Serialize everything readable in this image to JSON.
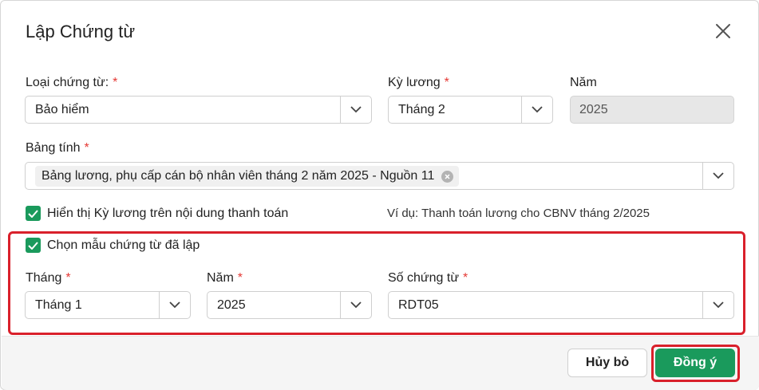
{
  "dialog": {
    "title": "Lập Chứng từ",
    "close_icon": "close-icon"
  },
  "fields": {
    "voucher_type": {
      "label": "Loại chứng từ:",
      "required": "*",
      "value": "Bảo hiểm"
    },
    "pay_period": {
      "label": "Kỳ lương",
      "required": "*",
      "value": "Tháng 2"
    },
    "year": {
      "label": "Năm",
      "value": "2025"
    },
    "spreadsheet": {
      "label": "Bảng tính",
      "required": "*",
      "tag": "Bảng lương, phụ cấp cán bộ nhân viên tháng 2 năm 2025 - Nguồn 11"
    }
  },
  "options": {
    "show_period": {
      "label": "Hiển thị Kỳ lương trên nội dung thanh toán",
      "checked": true
    },
    "example": "Ví dụ: Thanh toán lương cho CBNV tháng 2/2025",
    "choose_template": {
      "label": "Chọn mẫu chứng từ đã lập",
      "checked": true
    }
  },
  "template": {
    "month": {
      "label": "Tháng",
      "required": "*",
      "value": "Tháng 1"
    },
    "year": {
      "label": "Năm",
      "required": "*",
      "value": "2025"
    },
    "voucher_no": {
      "label": "Số chứng từ",
      "required": "*",
      "value": "RDT05"
    }
  },
  "footer": {
    "cancel_label": "Hủy bỏ",
    "ok_label": "Đồng ý"
  },
  "colors": {
    "accent": "#1a9a5c",
    "highlight": "#d9202b",
    "required": "#e53935"
  }
}
